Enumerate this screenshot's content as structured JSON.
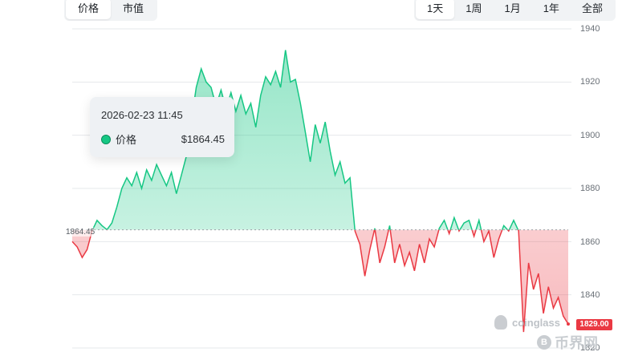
{
  "tabs_left": [
    {
      "label": "价格",
      "active": true
    },
    {
      "label": "市值",
      "active": false
    }
  ],
  "tabs_right": [
    {
      "label": "1天",
      "active": true
    },
    {
      "label": "1周",
      "active": false
    },
    {
      "label": "1月",
      "active": false
    },
    {
      "label": "1年",
      "active": false
    },
    {
      "label": "全部",
      "active": false
    }
  ],
  "tooltip": {
    "date": "2026-02-23 11:45",
    "series_label": "价格",
    "value": "$1864.45"
  },
  "reference_label": "1864.45",
  "current_price_label": "1829.00",
  "watermarks": {
    "coinglass": "coinglass",
    "bijiewang": "币界网",
    "coin_glyph": "B"
  },
  "colors": {
    "up": "#16c784",
    "down": "#ea3943",
    "up_fill": "#16c784",
    "down_fill": "#ea3943",
    "grid": "#e6e8eb"
  },
  "chart_data": {
    "type": "area",
    "y_ticks": [
      "1940",
      "1920",
      "1900",
      "1880",
      "1860",
      "1840",
      "1820"
    ],
    "y_tick_values": [
      1940,
      1920,
      1900,
      1880,
      1860,
      1840,
      1820
    ],
    "ylim": [
      1820,
      1940
    ],
    "x_range": [
      0,
      100
    ],
    "baseline": 1864.45,
    "last_value": 1829.0,
    "grid": true,
    "x": [
      0,
      1,
      2,
      3,
      4,
      5,
      6,
      7,
      8,
      9,
      10,
      11,
      12,
      13,
      14,
      15,
      16,
      17,
      18,
      19,
      20,
      21,
      22,
      23,
      24,
      25,
      26,
      27,
      28,
      29,
      30,
      31,
      32,
      33,
      34,
      35,
      36,
      37,
      38,
      39,
      40,
      41,
      42,
      43,
      44,
      45,
      46,
      47,
      48,
      49,
      50,
      51,
      52,
      53,
      54,
      55,
      56,
      57,
      58,
      59,
      60,
      61,
      62,
      63,
      64,
      65,
      66,
      67,
      68,
      69,
      70,
      71,
      72,
      73,
      74,
      75,
      76,
      77,
      78,
      79,
      80,
      81,
      82,
      83,
      84,
      85,
      86,
      87,
      88,
      89,
      90,
      91,
      92,
      93,
      94,
      95,
      96,
      97,
      98,
      99,
      100
    ],
    "values": [
      1860,
      1858,
      1854,
      1857,
      1864,
      1868,
      1866,
      1864.5,
      1867,
      1873,
      1880,
      1884,
      1881,
      1886,
      1880,
      1887,
      1883,
      1889,
      1885,
      1881,
      1886,
      1878,
      1885,
      1892,
      1905,
      1918,
      1925,
      1920,
      1918,
      1911,
      1917,
      1910,
      1916,
      1909,
      1915,
      1908,
      1912,
      1903,
      1915,
      1922,
      1919,
      1924,
      1918,
      1932,
      1920,
      1921,
      1912,
      1901,
      1890,
      1904,
      1897,
      1905,
      1894,
      1885,
      1890,
      1882,
      1884,
      1864,
      1859,
      1847,
      1857,
      1865,
      1852,
      1858,
      1866,
      1852,
      1859,
      1851,
      1856,
      1849,
      1859,
      1852,
      1861,
      1858,
      1865,
      1868,
      1863,
      1869,
      1864,
      1867,
      1868,
      1862,
      1868,
      1860,
      1864,
      1854,
      1861,
      1866,
      1864,
      1868,
      1864,
      1826,
      1852,
      1842,
      1848,
      1833,
      1843,
      1835,
      1839,
      1832,
      1829
    ]
  }
}
